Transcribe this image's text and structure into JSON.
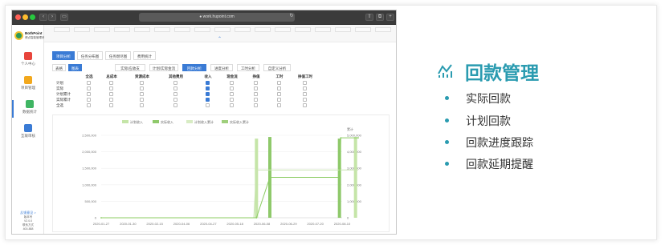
{
  "window": {
    "url": "● work.hupoint.com",
    "controls": {
      "close_color": "#ff5f56",
      "min_color": "#ffbd2e",
      "max_color": "#27c93f"
    }
  },
  "logo": {
    "name": "BothPoint",
    "tagline": "博点智能管理系统"
  },
  "sidebar": {
    "items": [
      {
        "label": "个人中心",
        "icon": "calendar-icon",
        "color": "#e8453c"
      },
      {
        "label": "项目管理",
        "icon": "folder-icon",
        "color": "#f2a81d"
      },
      {
        "label": "数据统计",
        "icon": "chart-icon",
        "color": "#3fb563"
      },
      {
        "label": "互联审核",
        "icon": "document-icon",
        "color": "#3a7bd5"
      }
    ],
    "footer": {
      "link": "反馈意见 >",
      "lines": [
        "版本号",
        "V2.0.0",
        "联系方式",
        "400-888"
      ]
    }
  },
  "top_ghost_tabs": [
    "",
    "",
    "",
    "",
    "",
    "",
    "",
    "",
    "",
    "",
    "",
    "",
    "",
    "",
    "",
    "",
    ""
  ],
  "tabs_primary": [
    {
      "label": "项目分析",
      "active": true
    },
    {
      "label": "任务分布图",
      "active": false
    },
    {
      "label": "任务燃尽图",
      "active": false
    },
    {
      "label": "费用统计",
      "active": false
    }
  ],
  "view_toggle": [
    {
      "label": "表格",
      "active": false
    },
    {
      "label": "图表",
      "active": true
    }
  ],
  "tabs_secondary": [
    {
      "label": "实际/应收支",
      "active": false
    },
    {
      "label": "计划/实际金流",
      "active": false
    },
    {
      "label": "回款分析",
      "active": true
    },
    {
      "label": "进度分析",
      "active": false
    },
    {
      "label": "工时分析",
      "active": false
    },
    {
      "label": "自定义分析",
      "active": false
    }
  ],
  "table": {
    "columns": [
      "全选",
      "总成本",
      "资源成本",
      "其他费用",
      "收入",
      "现金流",
      "挣值",
      "工时",
      "挣值工时"
    ],
    "rows": [
      "计划",
      "实际",
      "计划累计",
      "实际累计",
      "全选"
    ],
    "checked": [
      [
        4,
        0
      ],
      [
        4,
        1
      ],
      [
        4,
        2
      ],
      [
        4,
        3
      ]
    ]
  },
  "chart_data": {
    "type": "bar",
    "legend": [
      "计划收入",
      "实际收入",
      "计划收入累计",
      "实际收入累计"
    ],
    "series_colors": [
      "#c5e5a8",
      "#8fc96b",
      "#d8ecc4",
      "#9fcf7c"
    ],
    "x": [
      "2020-01-27",
      "2020-01-30",
      "2020-02-15",
      "2020-04-06",
      "2020-04-27",
      "2020-05-18",
      "2020-06-08",
      "2020-06-29",
      "2020-07-20",
      "2020-08-10"
    ],
    "ylim_left": [
      0,
      2500000
    ],
    "yticks_left": [
      "0",
      "500,000",
      "1,000,000",
      "1,500,000",
      "2,000,000",
      "2,500,000"
    ],
    "ylim_right": [
      0,
      5000000
    ],
    "yticks_right": [
      "0",
      "1,000,000",
      "2,000,000",
      "3,000,000",
      "4,000,000",
      "5,000,000"
    ],
    "right_axis_label": "累计",
    "bars_plan": [
      [
        5.8,
        2400000
      ],
      [
        9.5,
        2450000
      ]
    ],
    "bars_actual": [
      [
        6.3,
        2450000
      ],
      [
        8.9,
        2400000
      ]
    ],
    "cumulative_plan": [
      [
        0,
        0
      ],
      [
        5.7,
        0
      ],
      [
        5.8,
        2900000
      ],
      [
        8.8,
        2900000
      ],
      [
        8.9,
        2900000
      ],
      [
        9.6,
        2900000
      ]
    ],
    "cumulative_actual": [
      [
        0,
        0
      ],
      [
        5.8,
        0
      ],
      [
        6.3,
        2450000
      ],
      [
        8.9,
        2450000
      ],
      [
        8.95,
        4850000
      ],
      [
        9.6,
        4850000
      ]
    ]
  },
  "slide": {
    "title": "回款管理",
    "title_icon": "chart-line-icon",
    "accent": "#2a9bb0",
    "bullets": [
      "实际回款",
      "计划回款",
      "回款进度跟踪",
      "回款延期提醒"
    ]
  }
}
